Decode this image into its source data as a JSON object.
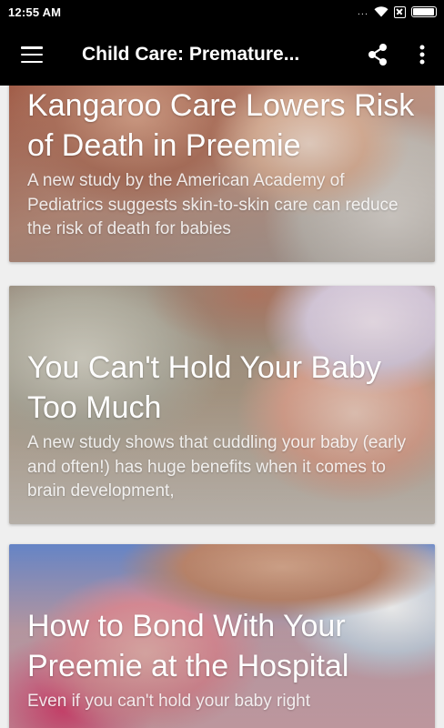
{
  "status_bar": {
    "time": "12:55 AM",
    "signal_dots": "...",
    "battery_level": 0.95
  },
  "app_bar": {
    "title": "Child Care: Premature...",
    "menu_icon": "hamburger-menu-icon",
    "share_icon": "share-icon",
    "more_icon": "more-vert-icon"
  },
  "articles": [
    {
      "title": "Kangaroo Care Lowers Risk of Death in Preemie",
      "description": "A new study by the American Academy of Pediatrics suggests skin-to-skin care can reduce the risk of death for babies"
    },
    {
      "title": "You Can't Hold Your Baby Too Much",
      "description": "A new study shows that cuddling your baby (early and often!) has huge benefits when it comes to brain development,"
    },
    {
      "title": "How to Bond With Your Preemie at the Hospital",
      "description": "Even if you can't hold your baby right"
    }
  ]
}
